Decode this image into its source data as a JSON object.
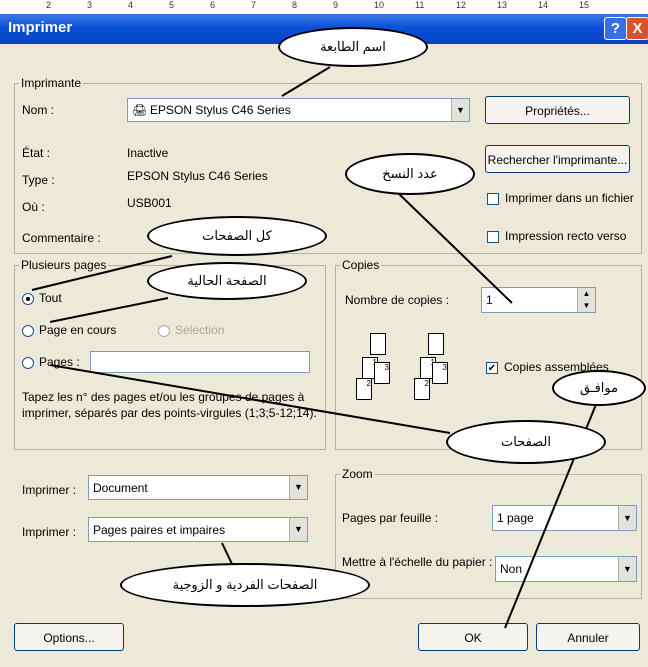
{
  "ruler": [
    "2",
    "3",
    "4",
    "5",
    "6",
    "7",
    "8",
    "9",
    "10",
    "11",
    "12",
    "13",
    "14",
    "15"
  ],
  "title": "Imprimer",
  "title_buttons": {
    "help": "?",
    "close": "X"
  },
  "printer": {
    "legend": "Imprimante",
    "name_label": "Nom :",
    "name_value": "EPSON Stylus C46 Series",
    "status_label": "État :",
    "status_value": "Inactive",
    "type_label": "Type :",
    "type_value": "EPSON Stylus C46 Series",
    "where_label": "Où :",
    "where_value": "USB001",
    "comment_label": "Commentaire :",
    "properties_button": "Propriétés...",
    "find_button": "Rechercher l'imprimante...",
    "print_to_file": "Imprimer dans un fichier",
    "duplex": "Impression recto verso"
  },
  "pages": {
    "legend": "Plusieurs pages",
    "all": "Tout",
    "current": "Page en cours",
    "selection": "Sélection",
    "pages": "Pages :",
    "hint": "Tapez les n° des pages et/ou les groupes de pages à imprimer, séparés par des points-virgules (1;3;5-12;14)."
  },
  "copies": {
    "legend": "Copies",
    "count_label": "Nombre de copies :",
    "count_value": "1",
    "collate": "Copies assemblées",
    "page_numbers": [
      "1",
      "2",
      "3",
      "1",
      "2",
      "3"
    ]
  },
  "print_what": {
    "label1": "Imprimer :",
    "value1": "Document",
    "label2": "Imprimer :",
    "value2": "Pages paires et impaires"
  },
  "zoom": {
    "legend": "Zoom",
    "per_sheet_label": "Pages par feuille :",
    "per_sheet_value": "1 page",
    "scale_label": "Mettre à l'échelle du papier :",
    "scale_value": "Non"
  },
  "buttons": {
    "options": "Options...",
    "ok": "OK",
    "cancel": "Annuler"
  },
  "callouts": {
    "printer_name": "اسم الطابعة",
    "copies": "عدد النسخ",
    "all_pages": "كل الصفحات",
    "current_page": "الصفحة الحالية",
    "pages": "الصفحات",
    "ok": "موافـق",
    "odd_even": "الصفحات الفردية و الزوجية"
  }
}
